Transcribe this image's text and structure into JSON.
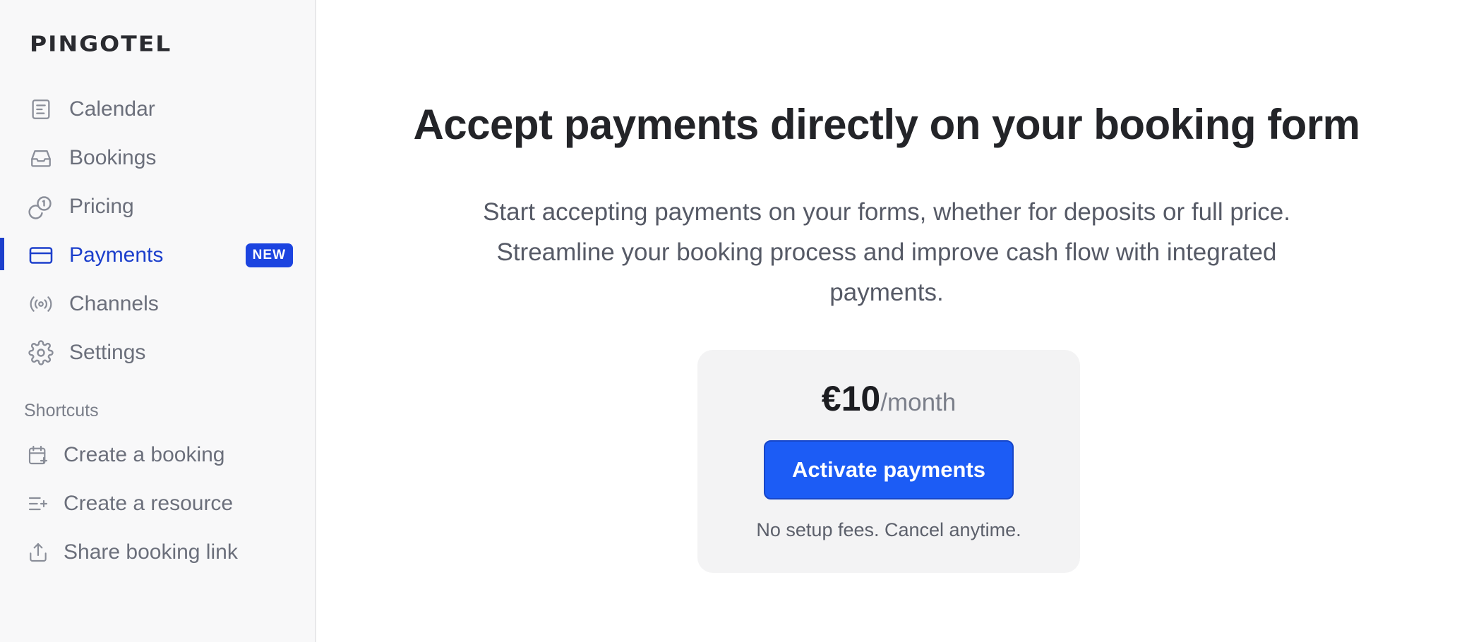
{
  "app": {
    "logo": "PINGOTEL"
  },
  "sidebar": {
    "items": [
      {
        "label": "Calendar",
        "icon": "calendar-list-icon"
      },
      {
        "label": "Bookings",
        "icon": "inbox-icon"
      },
      {
        "label": "Pricing",
        "icon": "coins-icon"
      },
      {
        "label": "Payments",
        "icon": "credit-card-icon",
        "active": true,
        "badge": "NEW"
      },
      {
        "label": "Channels",
        "icon": "broadcast-icon"
      },
      {
        "label": "Settings",
        "icon": "gear-icon"
      }
    ],
    "shortcuts_title": "Shortcuts",
    "shortcuts": [
      {
        "label": "Create a booking",
        "icon": "calendar-plus-icon"
      },
      {
        "label": "Create a resource",
        "icon": "list-plus-icon"
      },
      {
        "label": "Share booking link",
        "icon": "share-icon"
      }
    ]
  },
  "main": {
    "headline": "Accept payments directly on your booking form",
    "subtext": "Start accepting payments on your forms, whether for deposits or full price. Streamline your booking process and improve cash flow with integrated payments.",
    "price_amount": "€10",
    "price_period": "/month",
    "activate_label": "Activate payments",
    "note": "No setup fees. Cancel anytime."
  },
  "colors": {
    "accent": "#1c3fcc",
    "button": "#1c5cf5",
    "sidebar_bg": "#f8f8f9",
    "card_bg": "#f3f3f4"
  }
}
